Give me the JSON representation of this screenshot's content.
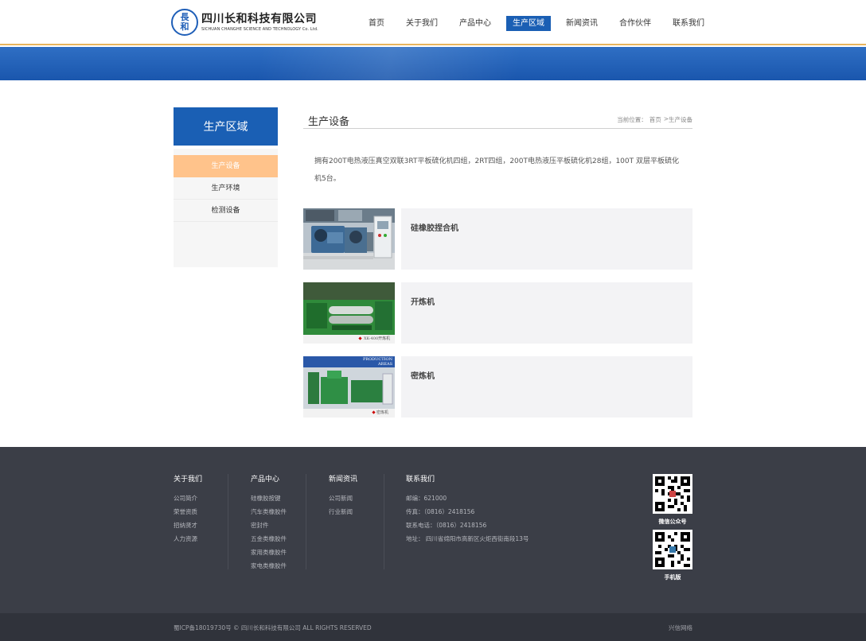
{
  "header": {
    "logo_glyph_1": "長",
    "logo_glyph_2": "和",
    "company_cn": "四川长和科技有限公司",
    "company_en": "SICHUAN CHANGHE SCIENCE AND TECHNOLOGY Co. Ltd.",
    "nav": [
      "首页",
      "关于我们",
      "产品中心",
      "生产区域",
      "新闻资讯",
      "合作伙伴",
      "联系我们"
    ],
    "nav_active": "生产区域"
  },
  "sidebar": {
    "title": "生产区域",
    "items": [
      "生产设备",
      "生产环境",
      "检测设备"
    ],
    "active": "生产设备"
  },
  "content": {
    "title": "生产设备",
    "breadcrumb": {
      "label": "当前位置：",
      "home": "首页",
      "sep": ">",
      "current": "生产设备"
    },
    "intro": "拥有200T电热液压真空双联3RT平板硫化机四组，2RT四组，200T电热液压平板硫化机28组，100T 双层平板硫化机5台。",
    "products": [
      {
        "name": "硅橡胶捏合机"
      },
      {
        "name": "开炼机",
        "caption": "XK-400开炼机"
      },
      {
        "name": "密炼机",
        "banner": "PRODUCTION AREAS",
        "caption": "密炼机"
      }
    ]
  },
  "footer": {
    "cols": [
      {
        "title": "关于我们",
        "links": [
          "公司简介",
          "荣誉资质",
          "招纳贤才",
          "人力资源"
        ]
      },
      {
        "title": "产品中心",
        "links": [
          "硅橡胶按键",
          "汽车类橡胶件",
          "密封件",
          "五金类橡胶件",
          "家用类橡胶件",
          "家电类橡胶件"
        ]
      },
      {
        "title": "新闻资讯",
        "links": [
          "公司新闻",
          "行业新闻"
        ]
      },
      {
        "title": "联系我们",
        "links": [
          "邮编：621000",
          "传真：（0816）2418156",
          "联系电话：（0816）2418156",
          "地址： 四川省绵阳市高新区火炬西街南段13号"
        ]
      }
    ],
    "qr_wechat_label": "微信公众号",
    "qr_mobile_label": "手机版",
    "copyright": "蜀ICP备18019730号 © 四川长和科技有限公司 ALL RIGHTS RESERVED",
    "credit": "兴信网络"
  },
  "colors": {
    "brand_blue": "#1a5fb4",
    "accent_orange": "#ffc38b",
    "footer_bg": "#3b3e47"
  }
}
